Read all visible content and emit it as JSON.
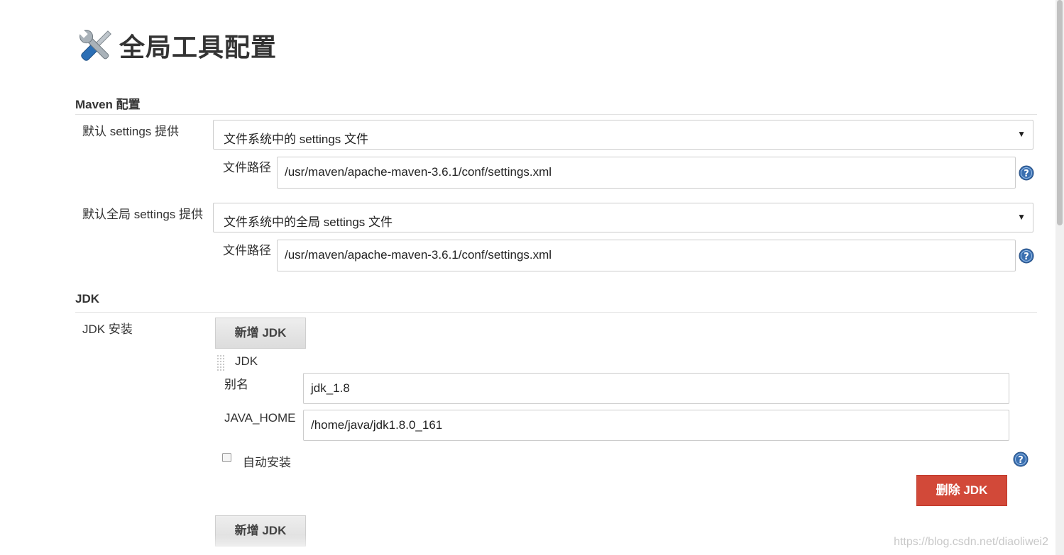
{
  "page": {
    "title": "全局工具配置"
  },
  "maven": {
    "section_title": "Maven 配置",
    "default_settings": {
      "label": "默认 settings 提供",
      "selected": "文件系统中的 settings 文件",
      "path_label": "文件路径",
      "path_value": "/usr/maven/apache-maven-3.6.1/conf/settings.xml"
    },
    "global_settings": {
      "label": "默认全局 settings 提供",
      "selected": "文件系统中的全局 settings 文件",
      "path_label": "文件路径",
      "path_value": "/usr/maven/apache-maven-3.6.1/conf/settings.xml"
    }
  },
  "jdk": {
    "section_title": "JDK",
    "install_label": "JDK 安装",
    "add_button": "新增 JDK",
    "entry": {
      "header": "JDK",
      "alias_label": "别名",
      "alias_value": "jdk_1.8",
      "java_home_label": "JAVA_HOME",
      "java_home_value": "/home/java/jdk1.8.0_161",
      "auto_install_label": "自动安装",
      "auto_install_checked": false
    },
    "delete_button": "删除 JDK",
    "add_button_bottom": "新增 JDK"
  },
  "watermark": "https://blog.csdn.net/diaoliwei2",
  "colors": {
    "delete_button": "#d24939",
    "help_icon": "#3a6fb0"
  }
}
